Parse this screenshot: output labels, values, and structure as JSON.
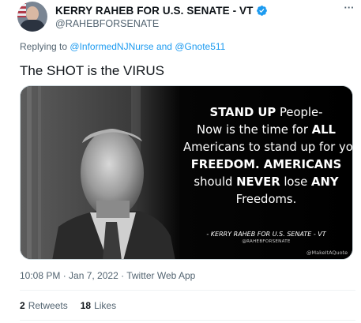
{
  "author": {
    "display_name": "KERRY RAHEB FOR U.S. SENATE - VT",
    "handle": "@RAHEBFORSENATE",
    "verified_icon": "verified-badge-icon",
    "more_icon": "more-options-icon"
  },
  "reply": {
    "prefix": "Replying to",
    "mention1": "@InformedNJNurse",
    "joiner": "and",
    "mention2": "@Gnote511"
  },
  "tweet_text": "The SHOT is the VIRUS",
  "media": {
    "quote_lines": [
      [
        {
          "t": "STAND UP",
          "b": true
        },
        {
          "t": " People-",
          "b": false
        }
      ],
      [
        {
          "t": "Now is the time for ",
          "b": false
        },
        {
          "t": "ALL",
          "b": true
        }
      ],
      [
        {
          "t": "Americans to stand up for your",
          "b": false
        }
      ],
      [
        {
          "t": "FREEDOM.  AMERICANS",
          "b": true
        }
      ],
      [
        {
          "t": "should ",
          "b": false
        },
        {
          "t": "NEVER",
          "b": true
        },
        {
          "t": " lose ",
          "b": false
        },
        {
          "t": "ANY",
          "b": true
        }
      ],
      [
        {
          "t": "Freedoms.",
          "b": false
        }
      ]
    ],
    "attribution": "- KERRY RAHEB FOR U.S. SENATE - VT",
    "attribution_handle": "@RAHEBFORSENATE",
    "watermark": "@MakeItAQuote"
  },
  "timestamp": "10:08 PM · Jan 7, 2022 · Twitter Web App",
  "stats": {
    "retweets_count": "2",
    "retweets_label": "Retweets",
    "likes_count": "18",
    "likes_label": "Likes"
  },
  "colors": {
    "accent": "#1d9bf0",
    "secondary_text": "#536471",
    "primary_text": "#0f1419"
  }
}
